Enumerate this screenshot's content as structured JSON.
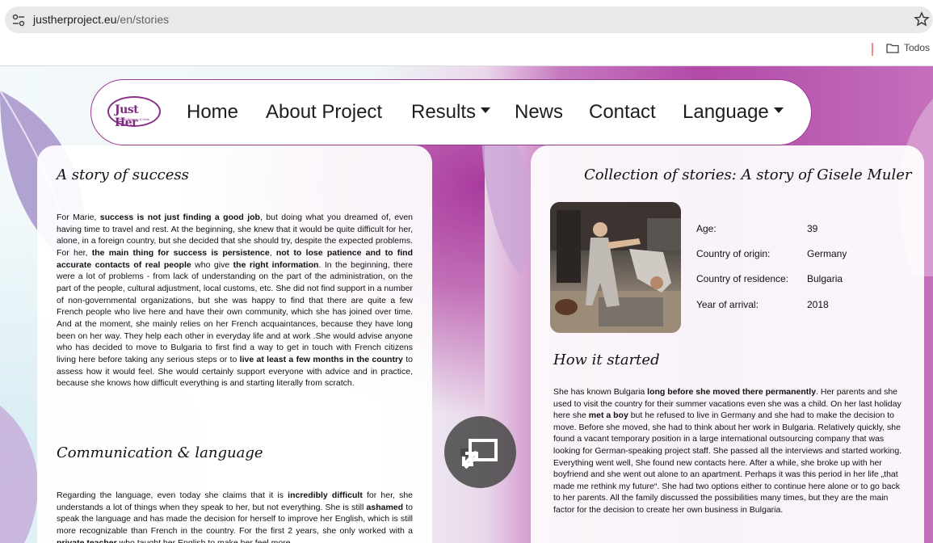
{
  "browser": {
    "url_host": "justherproject.eu",
    "url_path": "/en/stories",
    "bookmarks_folder": "Todos"
  },
  "nav": {
    "logo_text": "Just Her",
    "logo_subtext": "Strong Women & Girls",
    "items": [
      {
        "label": "Home",
        "dropdown": false
      },
      {
        "label": "About Project",
        "dropdown": false
      },
      {
        "label": "Results",
        "dropdown": true
      },
      {
        "label": "News",
        "dropdown": false
      },
      {
        "label": "Contact",
        "dropdown": false
      },
      {
        "label": "Language",
        "dropdown": true
      }
    ]
  },
  "left_card": {
    "title": "A story of success",
    "section2_title": "Communication & language"
  },
  "right_card": {
    "title": "Collection of stories: A story of Gisele Muler",
    "facts": [
      {
        "label": "Age:",
        "value": "39"
      },
      {
        "label": "Country of origin:",
        "value": "Germany"
      },
      {
        "label": "Country of residence:",
        "value": "Bulgaria"
      },
      {
        "label": "Year of arrival:",
        "value": "2018"
      }
    ],
    "section_title": "How it started"
  },
  "colors": {
    "brand_purple": "#8a2f86",
    "bg_magenta": "#b24aa8"
  }
}
